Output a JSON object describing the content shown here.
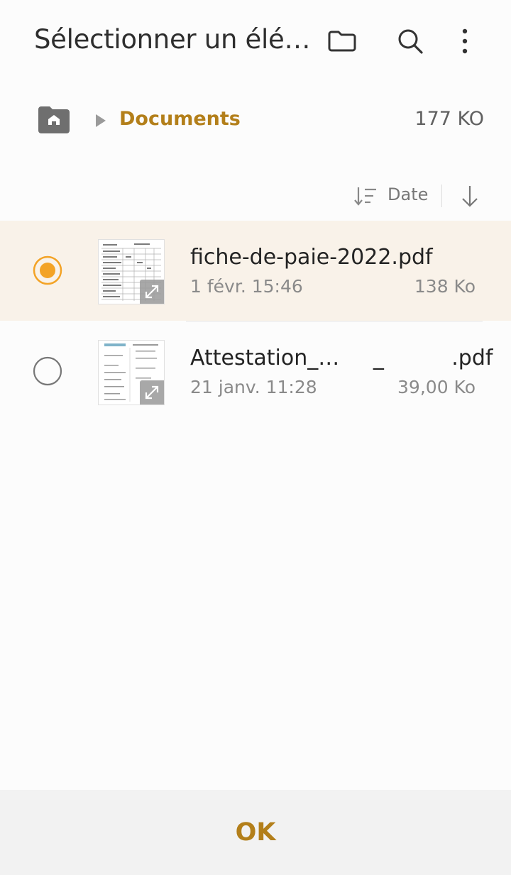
{
  "header": {
    "title": "Sélectionner un élé…",
    "icons": [
      "folder-icon",
      "search-icon",
      "more-vert-icon"
    ]
  },
  "breadcrumb": {
    "home_icon": "home-icon",
    "current": "Documents",
    "total_size": "177 KO"
  },
  "sort": {
    "label": "Date",
    "icon": "sort-lines-icon",
    "order_icon": "arrow-down-icon"
  },
  "files": [
    {
      "name": "fiche-de-paie-2022.pdf",
      "date": "1 févr. 15:46",
      "size": "138 Ko",
      "selected": true
    },
    {
      "name": "Attestation_…     _          .pdf",
      "date": "21 janv. 11:28",
      "size": "39,00 Ko",
      "selected": false
    }
  ],
  "footer": {
    "ok_label": "OK"
  },
  "colors": {
    "accent": "#b37f1a",
    "radio_selected": "#f3a326",
    "selected_row_bg": "#f9f2e9"
  }
}
